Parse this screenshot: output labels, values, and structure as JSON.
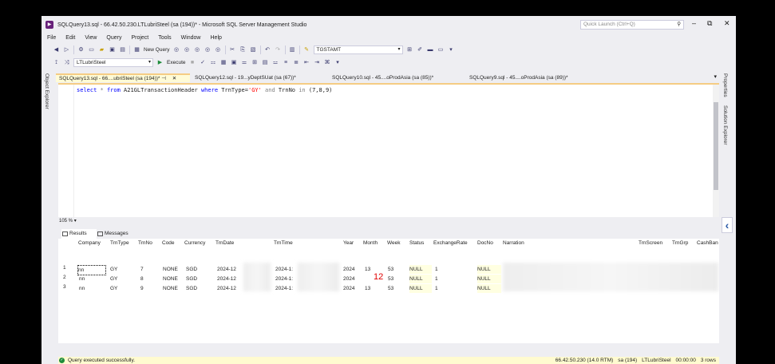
{
  "window": {
    "title": "SQLQuery13.sql - 66.42.50.230.LTLubriSteel (sa (194))* - Microsoft SQL Server Management Studio",
    "quick_launch_placeholder": "Quick Launch (Ctrl+Q)"
  },
  "menu": [
    "File",
    "Edit",
    "View",
    "Query",
    "Project",
    "Tools",
    "Window",
    "Help"
  ],
  "toolbar": {
    "new_query_label": "New Query",
    "search_combo_value": "TGSTAMT",
    "database_combo_value": "LTLubriSteel",
    "execute_label": "Execute"
  },
  "side_panels": {
    "left": "Object Explorer",
    "right_1": "Properties",
    "right_2": "Solution Explorer"
  },
  "doc_tabs": [
    {
      "label": "SQLQuery13.sql - 66....ubriSteel (sa (194))*",
      "active": true
    },
    {
      "label": "SQLQuery12.sql - 19...yDeptSUat (sa (67))*",
      "active": false
    },
    {
      "label": "SQLQuery10.sql - 45....oProdAsia (sa (85))*",
      "active": false
    },
    {
      "label": "SQLQuery9.sql - 45....oProdAsia (sa (89))*",
      "active": false
    }
  ],
  "editor": {
    "query": {
      "kw1": "select",
      "star": " * ",
      "kw2": "from",
      "table": " A21GLTransactionHeader ",
      "kw3": "where",
      "col1": " TrnType=",
      "str1": "'GY'",
      "kw4": " and ",
      "col2": "TrnNo ",
      "kw5": "in",
      "rest": " (7,8,9)"
    },
    "zoom": "105 %"
  },
  "result_tabs": {
    "results": "Results",
    "messages": "Messages"
  },
  "grid": {
    "headers": [
      "Company",
      "TrnType",
      "TrnNo",
      "Code",
      "Currency",
      "TrnDate",
      "TrnTime",
      "Year",
      "Month",
      "Week",
      "Status",
      "ExchangeRate",
      "DocNo",
      "Narration",
      "TrnScreen",
      "TrnGrp",
      "CashBan"
    ],
    "rows": [
      {
        "n": "1",
        "company": "nn",
        "trntype": "GY",
        "trnno": "7",
        "code": "NONE",
        "currency": "SGD",
        "trndate": "2024-12",
        "trntime": "2024-1:",
        "year": "2024",
        "month": "13",
        "week": "53",
        "status": "NULL",
        "rate": "1",
        "docno": "NULL"
      },
      {
        "n": "2",
        "company": "nn",
        "trntype": "GY",
        "trnno": "8",
        "code": "NONE",
        "currency": "SGD",
        "trndate": "2024-12",
        "trntime": "2024-1:",
        "year": "2024",
        "month": "12",
        "week": "53",
        "status": "NULL",
        "rate": "1",
        "docno": "NULL"
      },
      {
        "n": "3",
        "company": "nn",
        "trntype": "GY",
        "trnno": "9",
        "code": "NONE",
        "currency": "SGD",
        "trndate": "2024-12",
        "trntime": "2024-1:",
        "year": "2024",
        "month": "13",
        "week": "53",
        "status": "NULL",
        "rate": "1",
        "docno": "NULL"
      }
    ]
  },
  "status": {
    "message": "Query executed successfully.",
    "server": "66.42.50.230 (14.0 RTM)",
    "user": "sa (194)",
    "database": "LTLubriSteel",
    "elapsed": "00:00:00",
    "rows": "3 rows"
  }
}
